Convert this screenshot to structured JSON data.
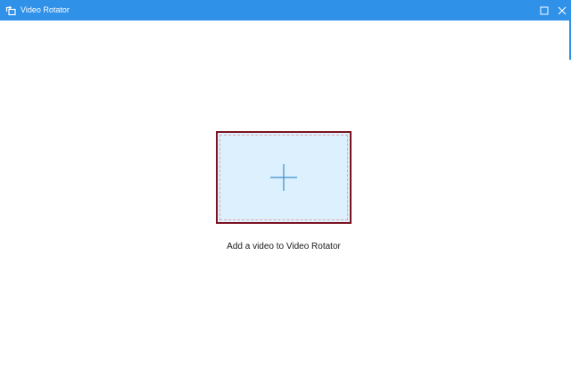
{
  "window": {
    "title": "Video Rotator",
    "app_icon": "rotate-icon",
    "controls": {
      "maximize_icon": "maximize-icon",
      "close_icon": "close-icon"
    },
    "titlebar_color": "#2f91e8"
  },
  "main": {
    "drop_zone": {
      "icon": "plus-icon",
      "fill_color": "#dcf0fd",
      "border_color": "#7d1220"
    },
    "prompt_text": "Add a video to Video Rotator"
  }
}
